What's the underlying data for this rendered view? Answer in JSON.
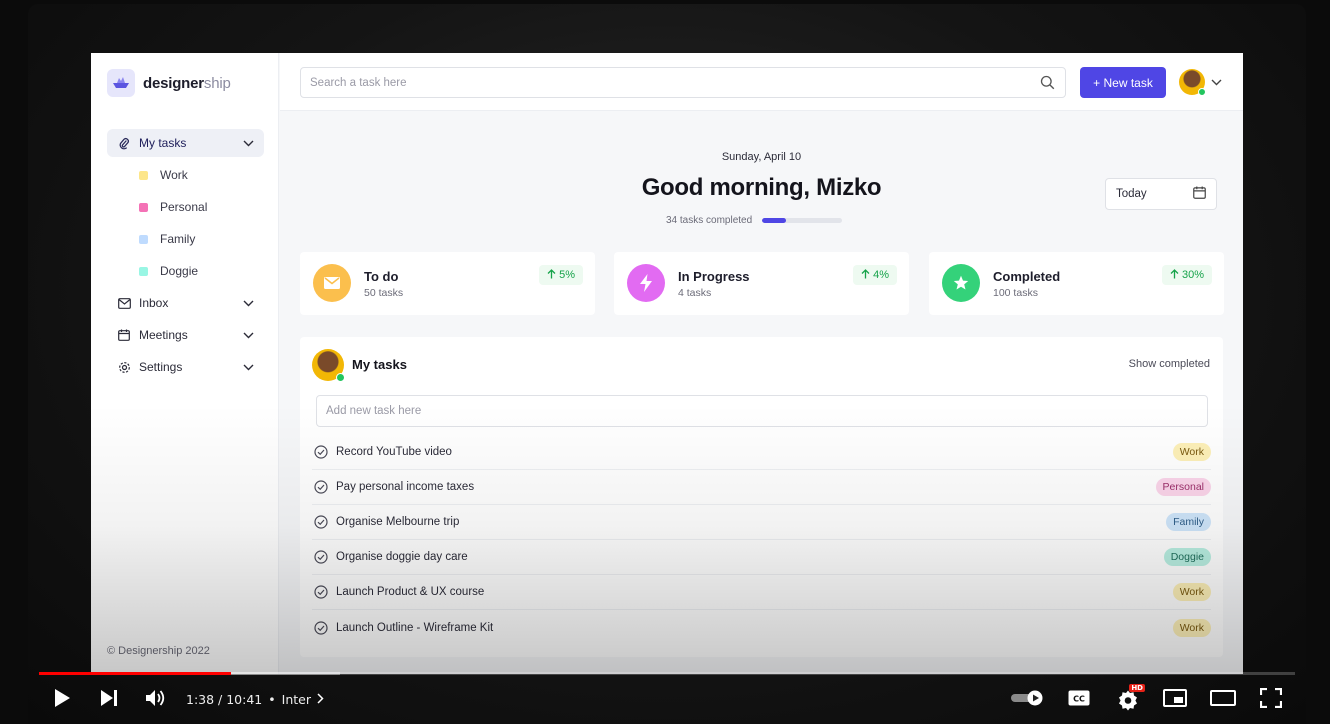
{
  "brand": {
    "name_bold": "designer",
    "name_light": "ship"
  },
  "sidebar": {
    "items": [
      {
        "label": "My tasks",
        "icon": "paperclip-icon",
        "active": true
      },
      {
        "label": "Inbox",
        "icon": "mail-icon"
      },
      {
        "label": "Meetings",
        "icon": "calendar-icon"
      },
      {
        "label": "Settings",
        "icon": "gear-icon"
      }
    ],
    "subitems": [
      {
        "label": "Work",
        "color": "#fde68a"
      },
      {
        "label": "Personal",
        "color": "#f472b6"
      },
      {
        "label": "Family",
        "color": "#bfdbfe"
      },
      {
        "label": "Doggie",
        "color": "#99f6e4"
      }
    ],
    "copyright": "© Designership 2022"
  },
  "topbar": {
    "search_placeholder": "Search a task here",
    "new_task_label": "+ New task"
  },
  "header": {
    "date": "Sunday, April 10",
    "greeting": "Good morning, Mizko",
    "tasks_completed": "34 tasks completed",
    "progress": 0.3,
    "today_label": "Today"
  },
  "stats": [
    {
      "title": "To do",
      "subtitle": "50 tasks",
      "pct": "5%",
      "color": "#fbbf4d",
      "icon": "mail-icon"
    },
    {
      "title": "In Progress",
      "subtitle": "4 tasks",
      "pct": "4%",
      "color": "#e26bf2",
      "icon": "lightning-icon"
    },
    {
      "title": "Completed",
      "subtitle": "100 tasks",
      "pct": "30%",
      "color": "#34d27a",
      "icon": "star-icon"
    }
  ],
  "tasks_panel": {
    "title": "My tasks",
    "show_completed": "Show completed",
    "add_placeholder": "Add new task here",
    "tasks": [
      {
        "label": "Record YouTube video",
        "tag": "Work",
        "tag_bg": "#fdf0b8",
        "tag_fg": "#7a5a10"
      },
      {
        "label": "Pay personal income taxes",
        "tag": "Personal",
        "tag_bg": "#fbd5ea",
        "tag_fg": "#9d2f6b"
      },
      {
        "label": "Organise Melbourne trip",
        "tag": "Family",
        "tag_bg": "#cfe6fb",
        "tag_fg": "#2f5f8a"
      },
      {
        "label": "Organise doggie day care",
        "tag": "Doggie",
        "tag_bg": "#b9efe2",
        "tag_fg": "#1f6f5c"
      },
      {
        "label": "Launch Product & UX course",
        "tag": "Work",
        "tag_bg": "#fdf0b8",
        "tag_fg": "#7a5a10"
      },
      {
        "label": "Launch Outline - Wireframe Kit",
        "tag": "Work",
        "tag_bg": "#fdf0b8",
        "tag_fg": "#7a5a10"
      }
    ]
  },
  "player": {
    "time": "1:38 / 10:41",
    "chapter": "Inter",
    "played_fraction": 0.153,
    "buffered_fraction": 0.24,
    "hd_badge": "HD",
    "accent": "#ff0000"
  }
}
